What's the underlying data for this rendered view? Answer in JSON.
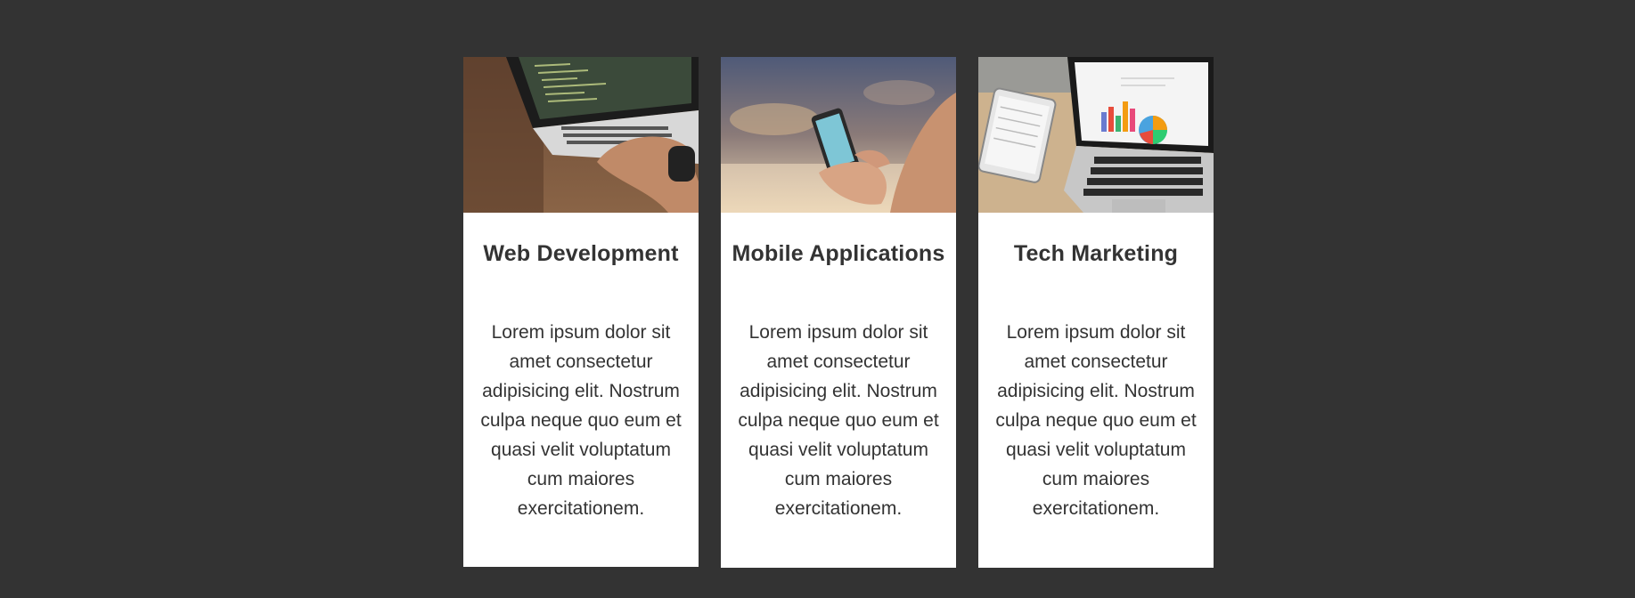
{
  "cards": [
    {
      "title": "Web Development",
      "text": "Lorem ipsum dolor sit amet consectetur adipisicing elit. Nostrum culpa neque quo eum et quasi velit voluptatum cum maiores exercitationem.",
      "image_icon": "laptop-code-photo"
    },
    {
      "title": "Mobile Applications",
      "text": "Lorem ipsum dolor sit amet consectetur adipisicing elit. Nostrum culpa neque quo eum et quasi velit voluptatum cum maiores exercitationem.",
      "image_icon": "smartphone-hand-photo"
    },
    {
      "title": "Tech Marketing",
      "text": "Lorem ipsum dolor sit amet consectetur adipisicing elit. Nostrum culpa neque quo eum et quasi velit voluptatum cum maiores exercitationem.",
      "image_icon": "laptop-charts-photo"
    }
  ],
  "colors": {
    "page_background": "#333333",
    "card_background": "#ffffff",
    "text": "#333333"
  }
}
